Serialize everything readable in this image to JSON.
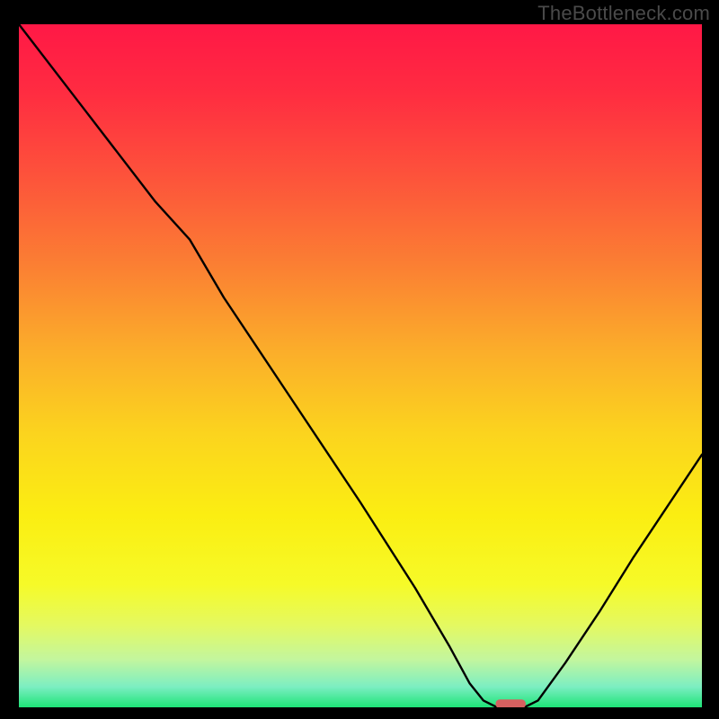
{
  "watermark": "TheBottleneck.com",
  "chart_data": {
    "type": "line",
    "title": "",
    "xlabel": "",
    "ylabel": "",
    "xlim": [
      0,
      100
    ],
    "ylim": [
      0,
      100
    ],
    "background_gradient": {
      "stops": [
        {
          "offset": 0.0,
          "color": "#ff1846"
        },
        {
          "offset": 0.1,
          "color": "#ff2c41"
        },
        {
          "offset": 0.22,
          "color": "#fd523b"
        },
        {
          "offset": 0.35,
          "color": "#fb7e33"
        },
        {
          "offset": 0.48,
          "color": "#fbae2a"
        },
        {
          "offset": 0.6,
          "color": "#fbd41e"
        },
        {
          "offset": 0.72,
          "color": "#fbee12"
        },
        {
          "offset": 0.82,
          "color": "#f6fa28"
        },
        {
          "offset": 0.88,
          "color": "#e4f961"
        },
        {
          "offset": 0.93,
          "color": "#c3f69e"
        },
        {
          "offset": 0.97,
          "color": "#7ceec2"
        },
        {
          "offset": 1.0,
          "color": "#1ee477"
        }
      ]
    },
    "series": [
      {
        "name": "bottleneck-curve",
        "color": "#000000",
        "points": [
          {
            "x": 0.0,
            "y": 100.0
          },
          {
            "x": 10.0,
            "y": 87.0
          },
          {
            "x": 20.0,
            "y": 74.0
          },
          {
            "x": 25.0,
            "y": 68.5
          },
          {
            "x": 30.0,
            "y": 60.0
          },
          {
            "x": 40.0,
            "y": 45.0
          },
          {
            "x": 50.0,
            "y": 30.0
          },
          {
            "x": 58.0,
            "y": 17.5
          },
          {
            "x": 63.0,
            "y": 9.0
          },
          {
            "x": 66.0,
            "y": 3.5
          },
          {
            "x": 68.0,
            "y": 1.0
          },
          {
            "x": 70.0,
            "y": 0.0
          },
          {
            "x": 74.0,
            "y": 0.0
          },
          {
            "x": 76.0,
            "y": 1.0
          },
          {
            "x": 80.0,
            "y": 6.5
          },
          {
            "x": 85.0,
            "y": 14.0
          },
          {
            "x": 90.0,
            "y": 22.0
          },
          {
            "x": 95.0,
            "y": 29.5
          },
          {
            "x": 100.0,
            "y": 37.0
          }
        ]
      }
    ],
    "marker": {
      "name": "optimal-point",
      "x": 72.0,
      "y": 0.5,
      "color": "#d66060"
    }
  }
}
